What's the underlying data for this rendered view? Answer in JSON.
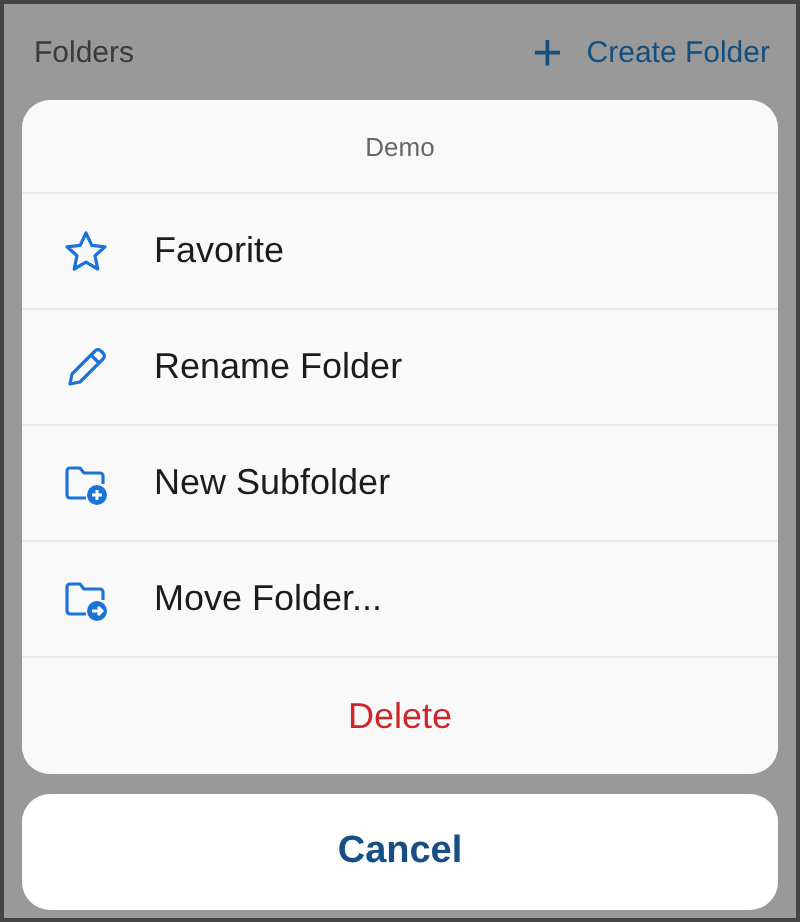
{
  "header": {
    "title": "Folders",
    "create_button": {
      "icon": "+",
      "label": "Create Folder"
    }
  },
  "sheet": {
    "title": "Demo",
    "actions": [
      {
        "kind": "star",
        "label": "Favorite"
      },
      {
        "kind": "pencil",
        "label": "Rename Folder"
      },
      {
        "kind": "folderplus",
        "label": "New Subfolder"
      },
      {
        "kind": "foldermove",
        "label": "Move Folder..."
      },
      {
        "kind": "destructive",
        "label": "Delete"
      }
    ]
  },
  "cancel": "Cancel"
}
